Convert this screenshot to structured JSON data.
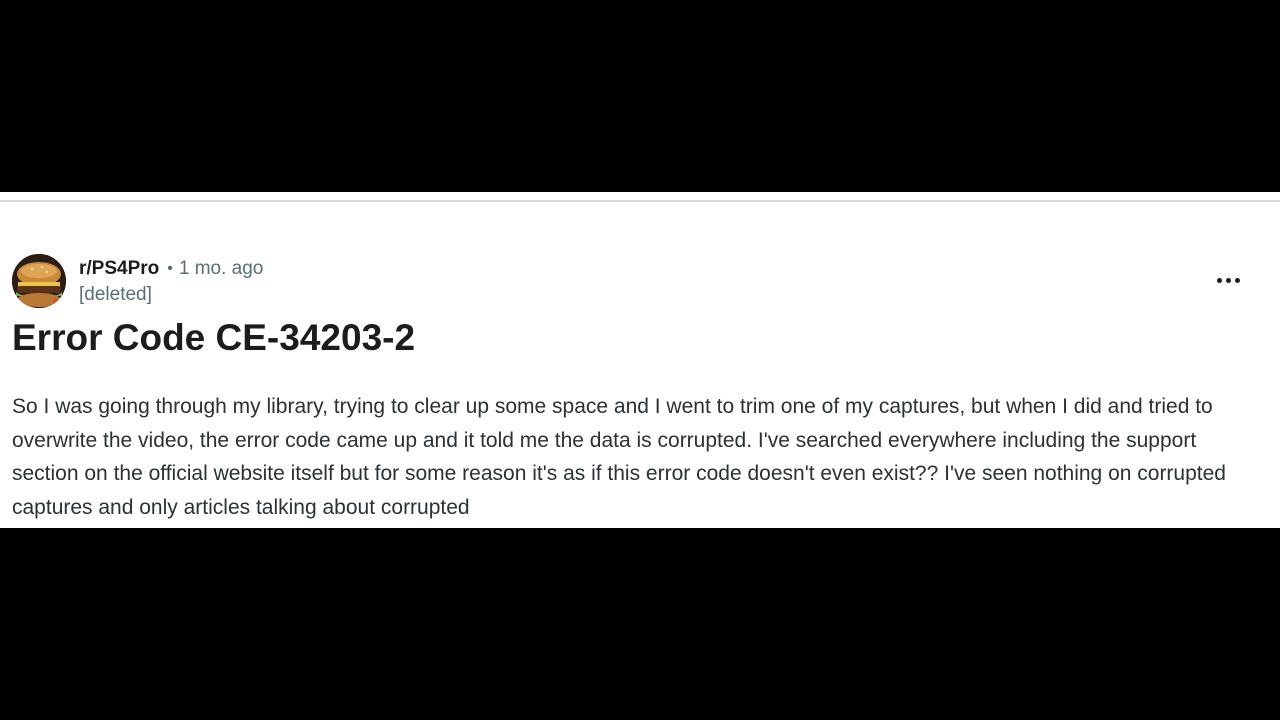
{
  "post": {
    "subreddit": "r/PS4Pro",
    "separator": "•",
    "time_ago": "1 mo. ago",
    "author": "[deleted]",
    "title": "Error Code CE-34203-2",
    "body": "So I was going through my library, trying to clear up some space and I went to trim one of my captures, but when I did and tried to overwrite the video, the error code came up and it told me the data is corrupted. I've searched everywhere including the support section on the official website itself but for some reason it's as if this error code doesn't even exist?? I've seen nothing on corrupted captures and only articles talking about corrupted",
    "more_icon": "more-horizontal-icon",
    "avatar_icon": "subreddit-avatar-burger"
  },
  "colors": {
    "letterbox": "#000000",
    "background": "#ffffff",
    "primary_text": "#1c1c1c",
    "secondary_text": "#576f76",
    "divider": "#d7dadc"
  }
}
